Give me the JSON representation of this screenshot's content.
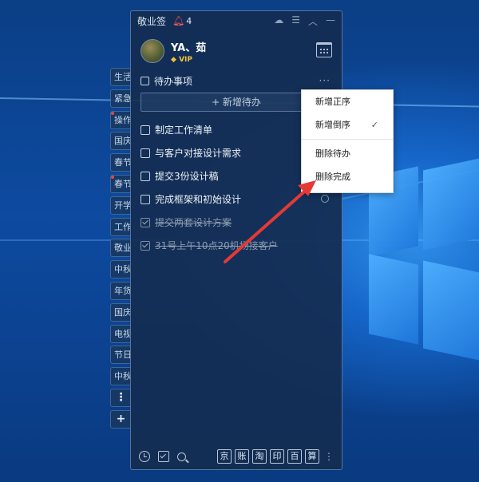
{
  "app": {
    "title": "敬业签",
    "notification_count": "4"
  },
  "user": {
    "name": "YA、茹",
    "badge": "VIP"
  },
  "section": {
    "title": "待办事项",
    "more": "···"
  },
  "add_button": "+ 新增待办",
  "todos": [
    {
      "text": "制定工作清单",
      "done": false
    },
    {
      "text": "与客户对接设计需求",
      "done": false
    },
    {
      "text": "提交3份设计稿",
      "done": false
    },
    {
      "text": "完成框架和初始设计",
      "done": false
    },
    {
      "text": "提交两套设计方案",
      "done": true
    },
    {
      "text": "31号上午10点20机场接客户",
      "done": true
    }
  ],
  "side_tabs": [
    "生活",
    "紧急",
    "操作",
    "国庆",
    "春节",
    "春节",
    "开学",
    "工作",
    "敬业",
    "中秋",
    "年货",
    "国庆",
    "电视",
    "节日",
    "中秋"
  ],
  "side_tools": [
    "⋮",
    "+"
  ],
  "quick_tools": [
    "京",
    "账",
    "淘",
    "印",
    "百",
    "算"
  ],
  "context_menu": {
    "items": [
      {
        "label": "新增正序",
        "checked": false
      },
      {
        "label": "新增倒序",
        "checked": true
      },
      {
        "label": "删除待办",
        "checked": false
      },
      {
        "label": "删除完成",
        "checked": false
      }
    ],
    "check_mark": "✓"
  },
  "colors": {
    "panel_bg": "#142d52",
    "accent_red": "#e53935",
    "vip_gold": "#f2c23c"
  }
}
